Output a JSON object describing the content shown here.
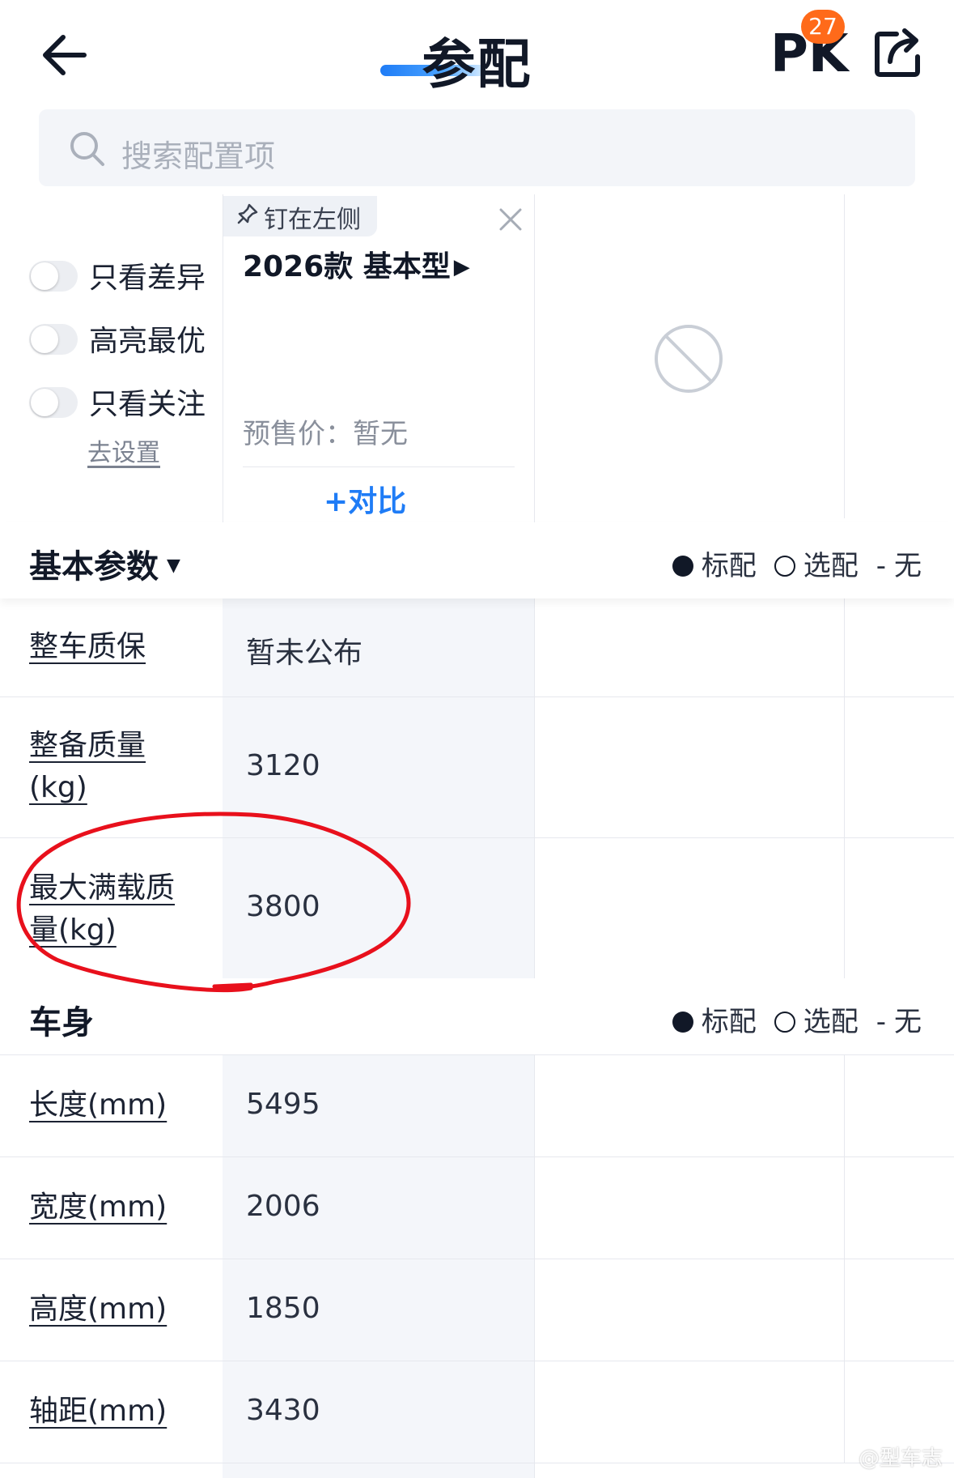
{
  "header": {
    "title": "参配",
    "pk_label": "PK",
    "pk_badge_count": "27"
  },
  "search": {
    "placeholder": "搜索配置项"
  },
  "filters": {
    "toggles": [
      {
        "label": "只看差异",
        "on": false
      },
      {
        "label": "高亮最优",
        "on": false
      },
      {
        "label": "只看关注",
        "on": false
      }
    ],
    "settings_link": "去设置"
  },
  "car_card": {
    "pin_label": "钉在左侧",
    "model_name": "2026款 基本型",
    "presale_price": "预售价：暂无",
    "compare_label": "+对比"
  },
  "legend": {
    "standard": "标配",
    "optional": "选配",
    "none": "无",
    "none_prefix": "-"
  },
  "sections": [
    {
      "title": "基本参数",
      "rows": [
        {
          "label": "整车质保",
          "value": "暂未公布"
        },
        {
          "label": "整备质量(kg)",
          "value": "3120"
        },
        {
          "label": "最大满载质量(kg)",
          "value": "3800"
        }
      ]
    },
    {
      "title": "车身",
      "rows": [
        {
          "label": "长度(mm)",
          "value": "5495"
        },
        {
          "label": "宽度(mm)",
          "value": "2006"
        },
        {
          "label": "高度(mm)",
          "value": "1850"
        },
        {
          "label": "轴距(mm)",
          "value": "3430"
        }
      ]
    }
  ],
  "watermark": "@型车志",
  "colors": {
    "accent": "#1f7cf6",
    "badge": "#ff6a1a",
    "annotation": "#e8101c"
  }
}
